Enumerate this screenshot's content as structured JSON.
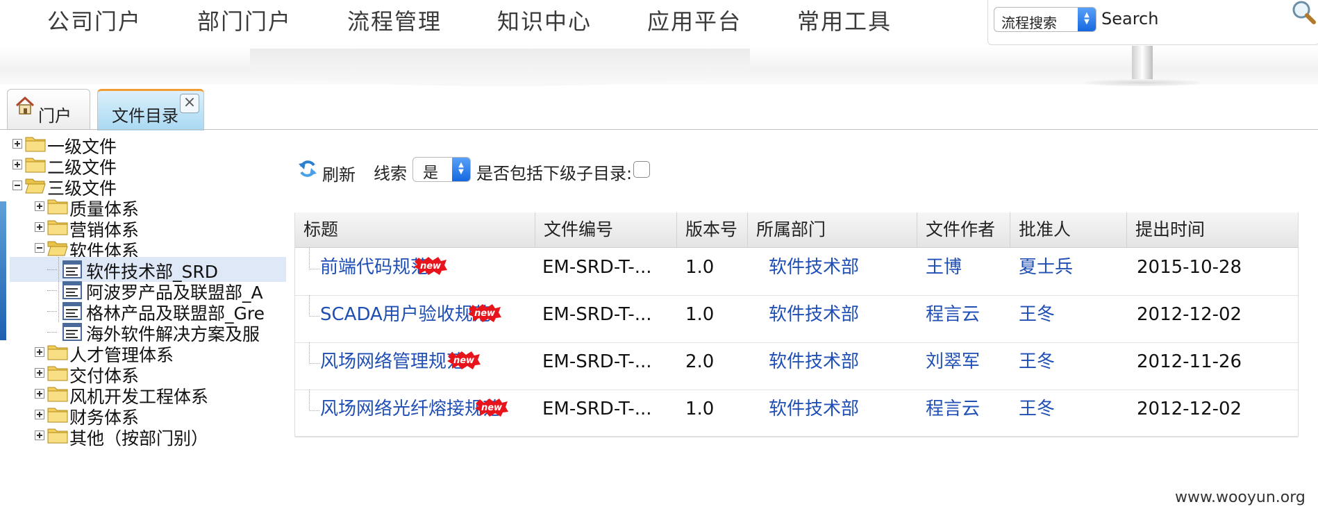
{
  "nav": {
    "items": [
      "公司门户",
      "部门门户",
      "流程管理",
      "知识中心",
      "应用平台",
      "常用工具"
    ]
  },
  "search": {
    "type_selected": "流程搜索",
    "placeholder": "Search"
  },
  "tabs": {
    "home_label": "门户",
    "docs_label": "文件目录"
  },
  "tree": {
    "nodes": [
      {
        "label": "一级文件",
        "kind": "folder",
        "state": "collapsed"
      },
      {
        "label": "二级文件",
        "kind": "folder",
        "state": "collapsed"
      },
      {
        "label": "三级文件",
        "kind": "folder",
        "state": "expanded"
      },
      {
        "label": "质量体系",
        "kind": "folder",
        "state": "collapsed"
      },
      {
        "label": "营销体系",
        "kind": "folder",
        "state": "collapsed"
      },
      {
        "label": "软件体系",
        "kind": "folder",
        "state": "expanded"
      },
      {
        "label": "软件技术部_SRD",
        "kind": "doc",
        "selected": true
      },
      {
        "label": "阿波罗产品及联盟部_A",
        "kind": "doc"
      },
      {
        "label": "格林产品及联盟部_Gre",
        "kind": "doc"
      },
      {
        "label": "海外软件解决方案及服",
        "kind": "doc"
      },
      {
        "label": "人才管理体系",
        "kind": "folder",
        "state": "collapsed"
      },
      {
        "label": "交付体系",
        "kind": "folder",
        "state": "collapsed"
      },
      {
        "label": "风机开发工程体系",
        "kind": "folder",
        "state": "collapsed"
      },
      {
        "label": "财务体系",
        "kind": "folder",
        "state": "collapsed"
      },
      {
        "label": "其他（按部门别）",
        "kind": "folder",
        "state": "collapsed"
      }
    ]
  },
  "toolbar": {
    "refresh_label": "刷新",
    "clue_label": "线索",
    "clue_selected": "是",
    "include_sub_label": "是否包括下级子目录:",
    "include_sub_checked": false
  },
  "table": {
    "headers": [
      "标题",
      "文件编号",
      "版本号",
      "所属部门",
      "文件作者",
      "批准人",
      "提出时间"
    ],
    "rows": [
      {
        "title": "前端代码规范",
        "code": "EM-SRD-T-...",
        "version": "1.0",
        "dept": "软件技术部",
        "author": "王博",
        "approver": "夏士兵",
        "date": "2015-10-28"
      },
      {
        "title": "SCADA用户验收规范",
        "code": "EM-SRD-T-...",
        "version": "1.0",
        "dept": "软件技术部",
        "author": "程言云",
        "approver": "王冬",
        "date": "2012-12-02"
      },
      {
        "title": "风场网络管理规范",
        "code": "EM-SRD-T-...",
        "version": "2.0",
        "dept": "软件技术部",
        "author": "刘翠军",
        "approver": "王冬",
        "date": "2012-11-26"
      },
      {
        "title": "风场网络光纤熔接规范",
        "code": "EM-SRD-T-...",
        "version": "1.0",
        "dept": "软件技术部",
        "author": "程言云",
        "approver": "王冬",
        "date": "2012-12-02"
      }
    ],
    "new_badge": "new"
  },
  "watermark": "www.wooyun.org",
  "colors": {
    "link": "#1f4fb4",
    "tab_active_top": "#f39c31",
    "tab_active_bg": "#a9d9f3",
    "select_arrow": "#1668e0",
    "new_badge": "#e8141b"
  }
}
